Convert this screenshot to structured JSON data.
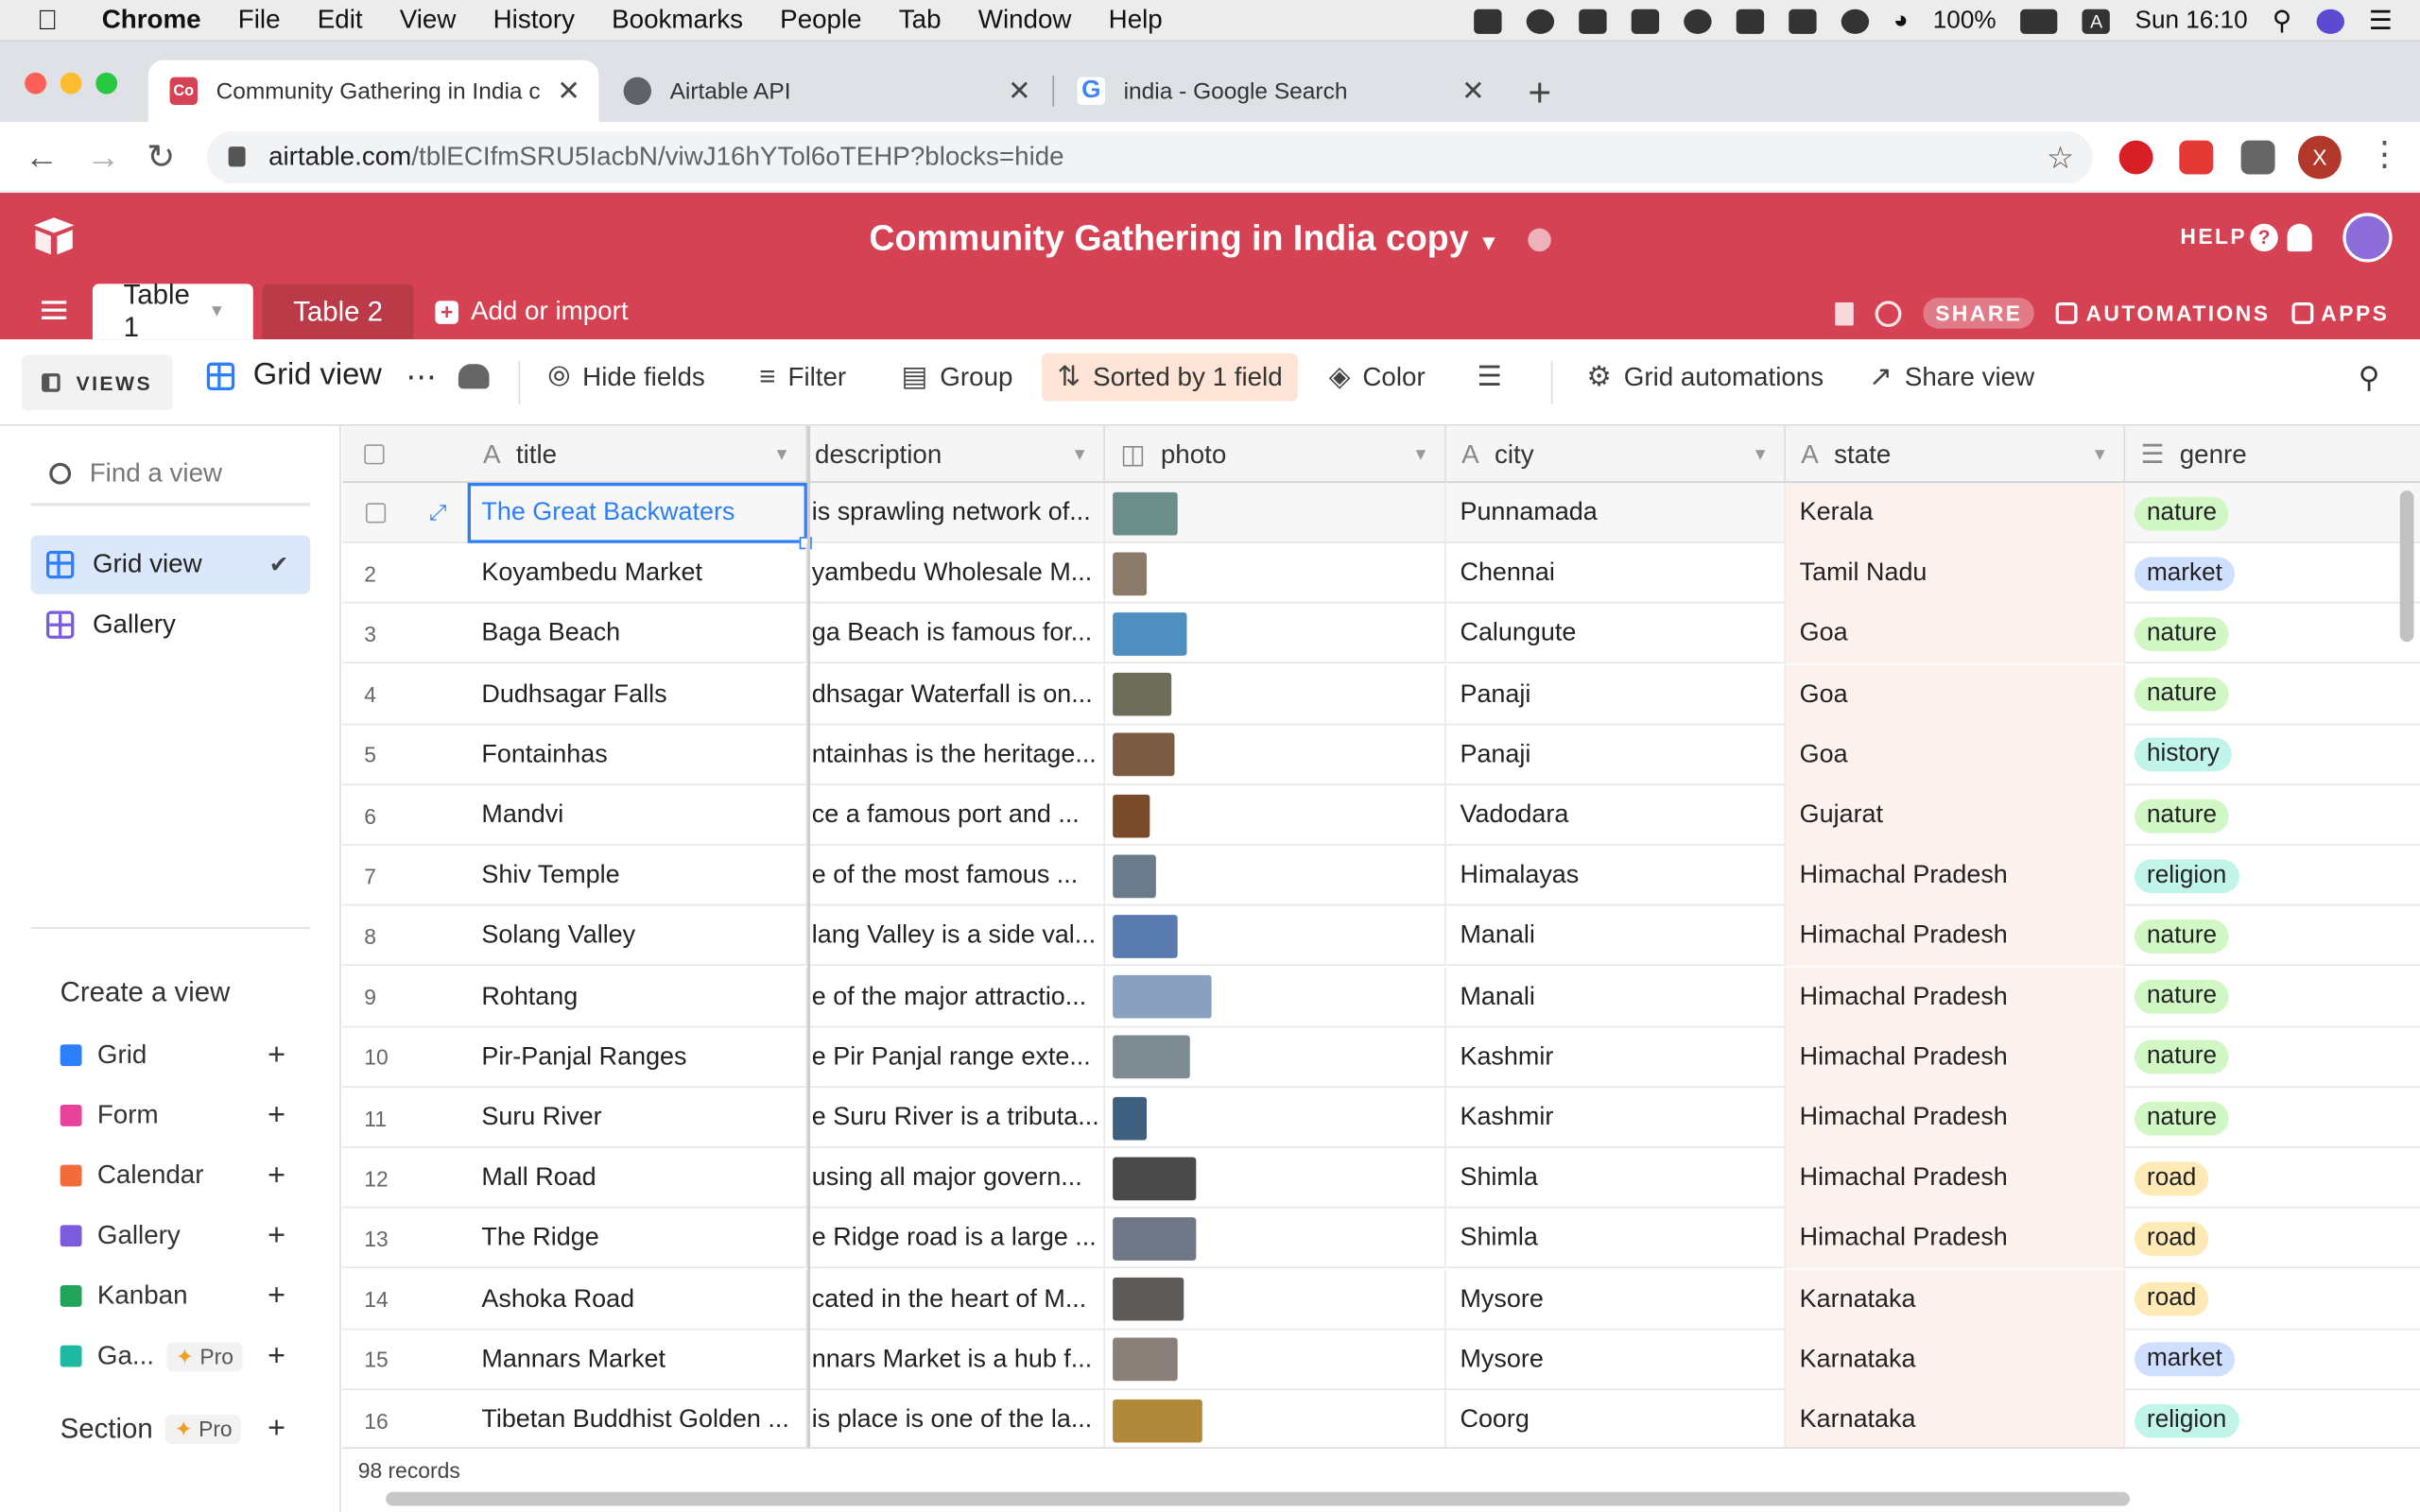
{
  "macmenu": {
    "app": "Chrome",
    "items": [
      "File",
      "Edit",
      "View",
      "History",
      "Bookmarks",
      "People",
      "Tab",
      "Window",
      "Help"
    ],
    "battery": "100%",
    "input": "A",
    "clock": "Sun 16:10"
  },
  "browser": {
    "tabs": [
      {
        "title": "Community Gathering in India c",
        "favicon": "Co",
        "favicon_color": "#d54253"
      },
      {
        "title": "Airtable API",
        "favicon": "globe-icon"
      },
      {
        "title": "india - Google Search",
        "favicon": "G"
      }
    ],
    "url_host": "airtable.com",
    "url_path": "/tblECIfmSRU5IacbN/viwJ16hYTol6oTEHP?blocks=hide",
    "profile_initial": "X"
  },
  "base": {
    "title": "Community Gathering in India copy",
    "help": "HELP",
    "tables": [
      "Table 1",
      "Table 2"
    ],
    "add_import": "Add or import",
    "share": "SHARE",
    "automations": "AUTOMATIONS",
    "apps": "APPS"
  },
  "viewbar": {
    "views": "VIEWS",
    "current_view": "Grid view",
    "hide_fields": "Hide fields",
    "filter": "Filter",
    "group": "Group",
    "sorted": "Sorted by 1 field",
    "color": "Color",
    "grid_automations": "Grid automations",
    "share_view": "Share view"
  },
  "sidebar": {
    "find_placeholder": "Find a view",
    "views": [
      "Grid view",
      "Gallery"
    ],
    "create_label": "Create a view",
    "create_items": [
      "Grid",
      "Form",
      "Calendar",
      "Gallery",
      "Kanban",
      "Ga..."
    ],
    "pro": "Pro",
    "section": "Section"
  },
  "grid": {
    "columns": [
      "title",
      "description",
      "photo",
      "city",
      "state",
      "genre"
    ],
    "rows": [
      {
        "n": "",
        "title": "The Great Backwaters",
        "description": "is sprawling network of...",
        "city": "Punnamada",
        "state": "Kerala",
        "genre": "nature"
      },
      {
        "n": "2",
        "title": "Koyambedu Market",
        "description": "yambedu Wholesale M...",
        "city": "Chennai",
        "state": "Tamil Nadu",
        "genre": "market"
      },
      {
        "n": "3",
        "title": "Baga Beach",
        "description": "ga Beach is famous for...",
        "city": "Calungute",
        "state": "Goa",
        "genre": "nature"
      },
      {
        "n": "4",
        "title": "Dudhsagar Falls",
        "description": "dhsagar Waterfall is on...",
        "city": "Panaji",
        "state": "Goa",
        "genre": "nature"
      },
      {
        "n": "5",
        "title": "Fontainhas",
        "description": "ntainhas is the heritage...",
        "city": "Panaji",
        "state": "Goa",
        "genre": "history"
      },
      {
        "n": "6",
        "title": "Mandvi",
        "description": "ce a famous port and ...",
        "city": "Vadodara",
        "state": "Gujarat",
        "genre": "nature"
      },
      {
        "n": "7",
        "title": "Shiv Temple",
        "description": "e of the most famous ...",
        "city": "Himalayas",
        "state": "Himachal Pradesh",
        "genre": "religion"
      },
      {
        "n": "8",
        "title": "Solang Valley",
        "description": "lang Valley is a side val...",
        "city": "Manali",
        "state": "Himachal Pradesh",
        "genre": "nature"
      },
      {
        "n": "9",
        "title": "Rohtang",
        "description": "e of the major attractio...",
        "city": "Manali",
        "state": "Himachal Pradesh",
        "genre": "nature"
      },
      {
        "n": "10",
        "title": "Pir-Panjal Ranges",
        "description": "e Pir Panjal range exte...",
        "city": "Kashmir",
        "state": "Himachal Pradesh",
        "genre": "nature"
      },
      {
        "n": "11",
        "title": "Suru River",
        "description": "e Suru River is a tributa...",
        "city": "Kashmir",
        "state": "Himachal Pradesh",
        "genre": "nature"
      },
      {
        "n": "12",
        "title": "Mall Road",
        "description": "using all major govern...",
        "city": "Shimla",
        "state": "Himachal Pradesh",
        "genre": "road"
      },
      {
        "n": "13",
        "title": "The Ridge",
        "description": "e Ridge road is a large ...",
        "city": "Shimla",
        "state": "Himachal Pradesh",
        "genre": "road"
      },
      {
        "n": "14",
        "title": "Ashoka Road",
        "description": "cated in the heart of M...",
        "city": "Mysore",
        "state": "Karnataka",
        "genre": "road"
      },
      {
        "n": "15",
        "title": "Mannars Market",
        "description": "nnars Market is a hub f...",
        "city": "Mysore",
        "state": "Karnataka",
        "genre": "market"
      },
      {
        "n": "16",
        "title": "Tibetan Buddhist Golden ...",
        "description": "is place is one of the la...",
        "city": "Coorg",
        "state": "Karnataka",
        "genre": "religion"
      }
    ],
    "genre_colors": {
      "nature": "#d1f7c4",
      "market": "#cfdfff",
      "history": "#c2f5e9",
      "religion": "#c2f5e9",
      "road": "#ffeab6"
    },
    "record_count": "98 records"
  },
  "colors": {
    "brand": "#d54253",
    "accent": "#2d7ff9"
  }
}
